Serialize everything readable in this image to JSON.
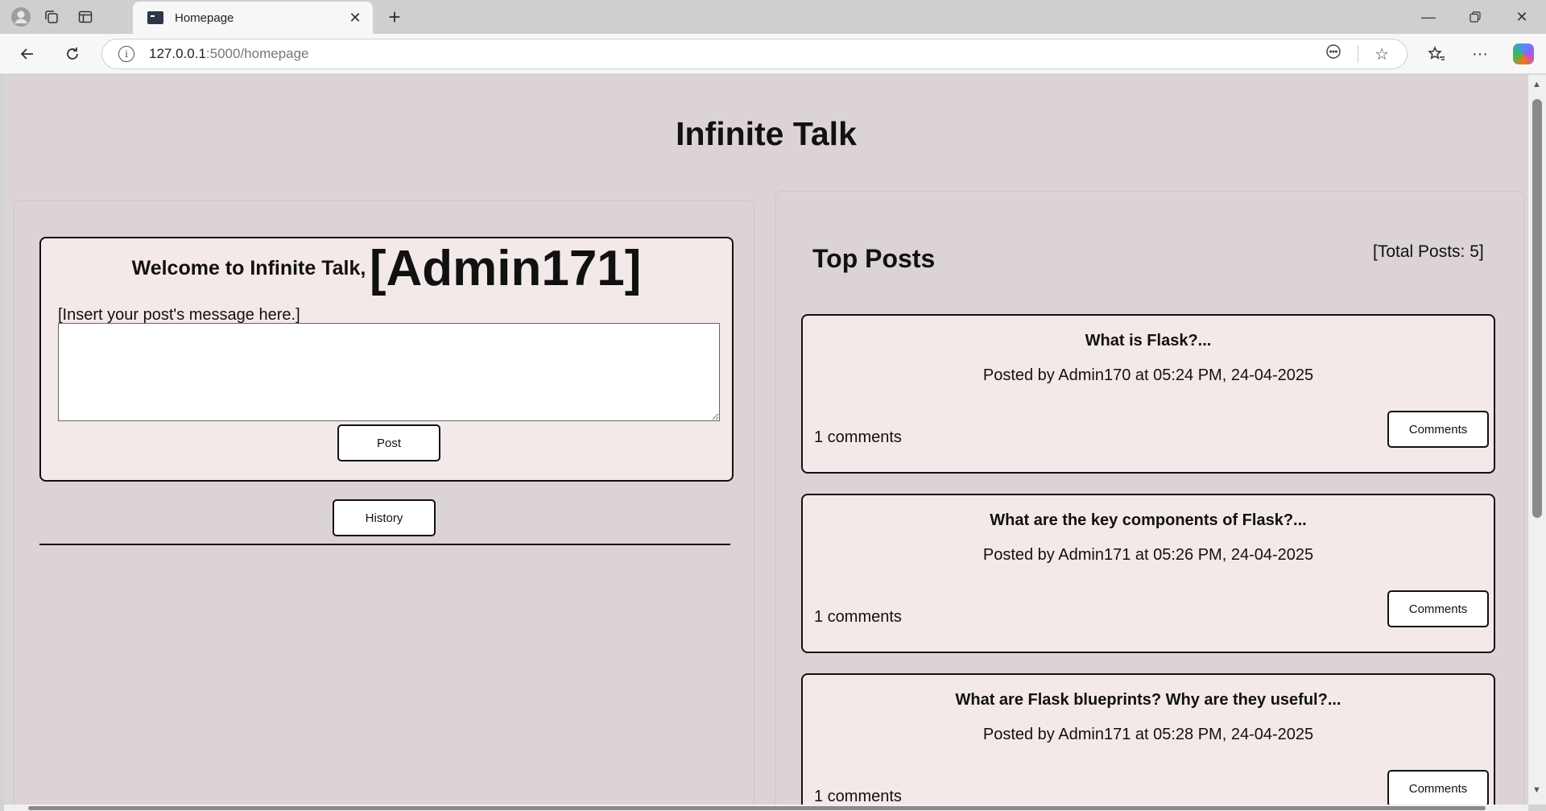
{
  "browser": {
    "tab_title": "Homepage",
    "url_host": "127.0.0.1",
    "url_rest": ":5000/homepage"
  },
  "page": {
    "site_title": "Infinite Talk",
    "welcome_prefix": "Welcome to Infinite Talk,",
    "username": "[Admin171]",
    "message_label": "[Insert your post's message here.]",
    "message_value": "",
    "post_button": "Post",
    "history_button": "History",
    "top_posts_heading": "Top Posts",
    "total_posts": "[Total Posts: 5]",
    "posts": [
      {
        "title": "What is Flask?...",
        "meta": "Posted by Admin170 at 05:24 PM, 24-04-2025",
        "comments": "1 comments",
        "button": "Comments"
      },
      {
        "title": "What are the key components of Flask?...",
        "meta": "Posted by Admin171 at 05:26 PM, 24-04-2025",
        "comments": "1 comments",
        "button": "Comments"
      },
      {
        "title": "What are Flask blueprints? Why are they useful?...",
        "meta": "Posted by Admin171 at 05:28 PM, 24-04-2025",
        "comments": "1 comments",
        "button": "Comments"
      }
    ]
  }
}
